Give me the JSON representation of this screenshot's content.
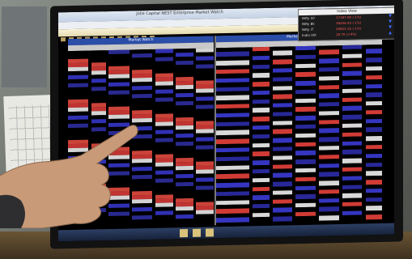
{
  "window": {
    "title": "Jolie Capital  NEST Enterprise  Market Watch"
  },
  "index_popup": {
    "title": "Index View",
    "rows": [
      {
        "name": "Nifty 50",
        "value": "17187.90",
        "change": "(-1%)"
      },
      {
        "name": "Nifty Bk",
        "value": "38456.45",
        "change": "(-1%)"
      },
      {
        "name": "Nifty IT",
        "value": "29823.15",
        "change": "(-1%)"
      },
      {
        "name": "India VIX",
        "value": "18.70",
        "change": "(+4%)"
      }
    ]
  },
  "panes": {
    "left_title": "Market Watch",
    "right_title": "Market Watch"
  },
  "icons": [
    "hand-pointing"
  ],
  "colors": {
    "sell": "#e8413b",
    "buy": "#3b3bd6",
    "up": "#e7e7e7",
    "window_title": "#2b4ea8"
  }
}
